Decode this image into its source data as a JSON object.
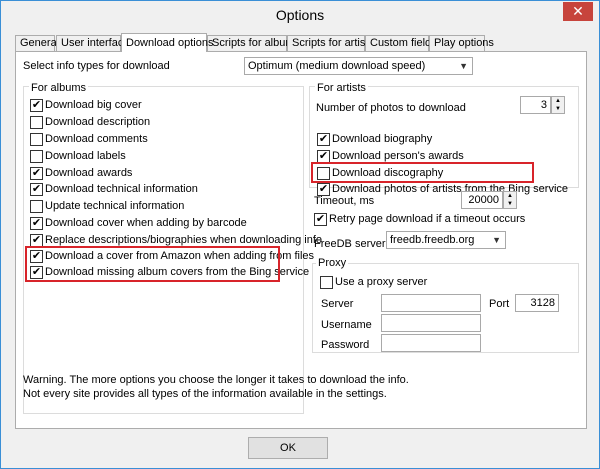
{
  "window": {
    "title": "Options",
    "close_glyph": "✕"
  },
  "tabs": [
    "General",
    "User interface",
    "Download options",
    "Scripts for albums",
    "Scripts for artists",
    "Custom fields",
    "Play options"
  ],
  "active_tab": "Download options",
  "info_types": {
    "label": "Select info types for download",
    "value": "Optimum (medium download speed)"
  },
  "albums": {
    "title": "For albums",
    "items": [
      {
        "label": "Download big cover",
        "checked": true
      },
      {
        "label": "Download description",
        "checked": false
      },
      {
        "label": "Download comments",
        "checked": false
      },
      {
        "label": "Download labels",
        "checked": false
      },
      {
        "label": "Download awards",
        "checked": true
      },
      {
        "label": "Download technical information",
        "checked": true
      },
      {
        "label": "Update technical information",
        "checked": false
      },
      {
        "label": "Download cover when adding by barcode",
        "checked": true
      },
      {
        "label": "Replace descriptions/biographies when downloading info",
        "checked": true
      },
      {
        "label": "Download a cover from Amazon when adding from files",
        "checked": true
      },
      {
        "label": "Download missing album covers from the Bing service",
        "checked": true
      }
    ]
  },
  "artists": {
    "title": "For artists",
    "photos_label": "Number of photos to download",
    "photos_value": "3",
    "items": [
      {
        "label": "Download biography",
        "checked": true
      },
      {
        "label": "Download person's awards",
        "checked": true
      },
      {
        "label": "Download discography",
        "checked": false
      },
      {
        "label": "Download photos of artists from the Bing service",
        "checked": true
      }
    ]
  },
  "timeout": {
    "label": "Timeout, ms",
    "value": "20000"
  },
  "retry": {
    "label": "Retry page download if a timeout occurs",
    "checked": true
  },
  "freedb": {
    "label": "FreeDB server",
    "value": "freedb.freedb.org"
  },
  "proxy": {
    "title": "Proxy",
    "use_label": "Use a proxy server",
    "use_checked": false,
    "server_label": "Server",
    "port_label": "Port",
    "port_value": "3128",
    "username_label": "Username",
    "password_label": "Password"
  },
  "warning": {
    "line1": "Warning. The more options you choose the longer it takes to download the info.",
    "line2": "Not every site provides all types of the information available in the settings."
  },
  "ok_label": "OK",
  "check_glyph": "✔",
  "colors": {
    "highlight": "#d8242a",
    "title_border": "#3a8fd6",
    "close": "#c7443c"
  }
}
